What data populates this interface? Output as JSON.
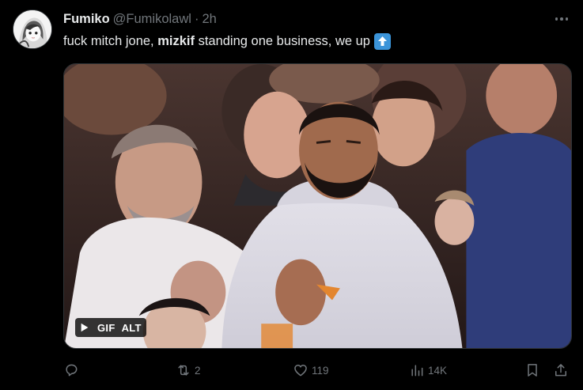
{
  "tweet": {
    "display_name": "Fumiko",
    "handle": "@Fumikolawl",
    "separator": "·",
    "time": "2h",
    "text_pre": "fuck mitch jone, ",
    "text_bold": "mizkif",
    "text_post": " standing one business, we up",
    "emoji": "up-arrow-emoji"
  },
  "media": {
    "type_badge": "GIF",
    "alt_badge": "ALT"
  },
  "actions": {
    "reply_count": "",
    "retweet_count": "2",
    "like_count": "119",
    "views_count": "14K"
  },
  "colors": {
    "background": "#000000",
    "text": "#e7e9ea",
    "muted": "#71767b",
    "border": "#2f3336",
    "emoji_blue": "#3b94d9"
  },
  "icons": [
    "avatar-image",
    "more-icon",
    "play-icon",
    "reply-icon",
    "retweet-icon",
    "like-icon",
    "views-icon",
    "bookmark-icon",
    "share-icon"
  ]
}
